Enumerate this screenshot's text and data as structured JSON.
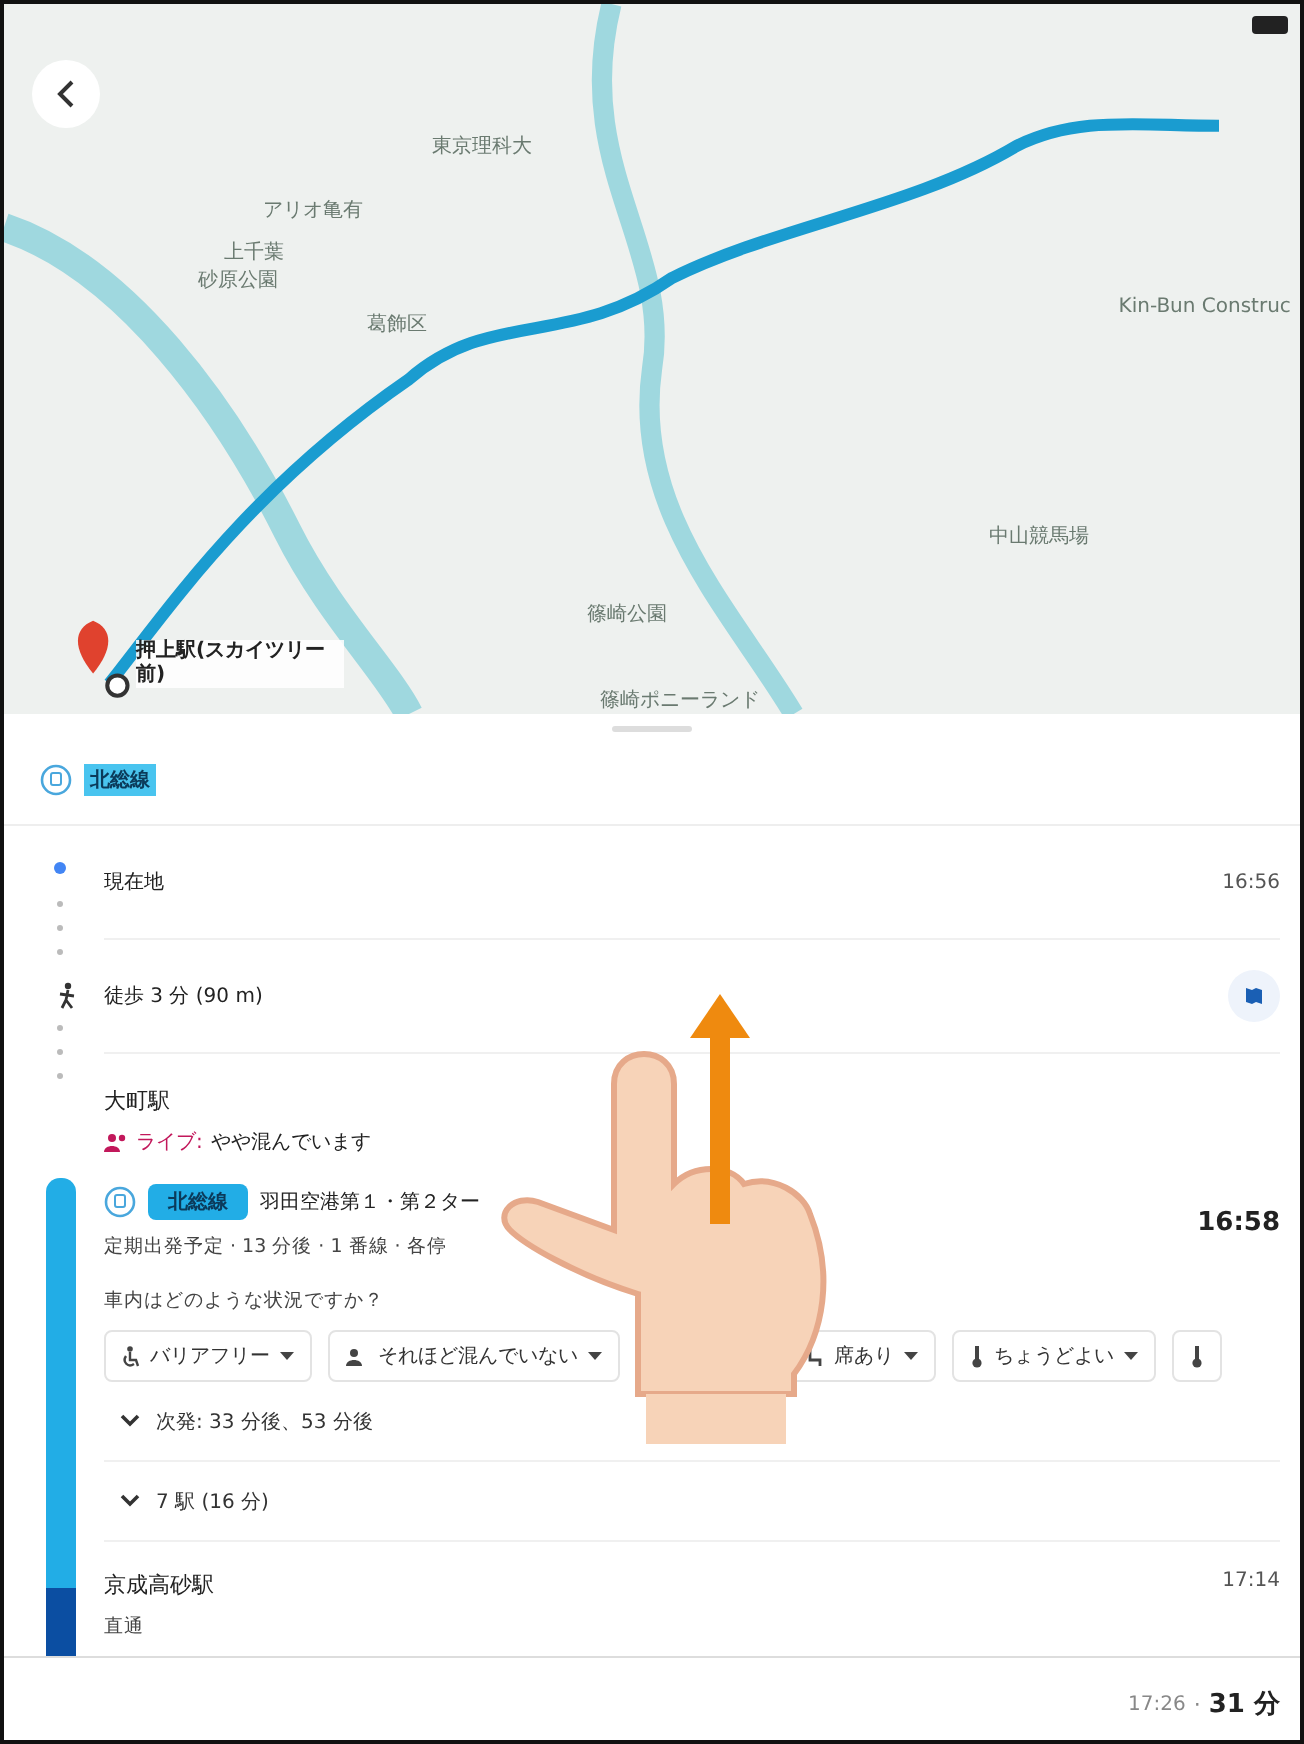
{
  "map": {
    "labels": [
      {
        "text": "東京理科大"
      },
      {
        "text": "アリオ亀有"
      },
      {
        "text": "上千葉"
      },
      {
        "text": "砂原公園"
      },
      {
        "text": "葛飾区"
      },
      {
        "text": "中山競馬場"
      },
      {
        "text": "篠崎公園"
      },
      {
        "text": "篠崎ポニーランド"
      },
      {
        "text": "Kin-Bun Construc"
      }
    ],
    "destination": "押上駅(スカイツリー前)"
  },
  "route_header": {
    "line": "北総線"
  },
  "steps": [
    {
      "kind": "place",
      "name": "現在地",
      "time": "16:56"
    },
    {
      "kind": "walk",
      "name": "徒歩 3 分 (90 m)"
    }
  ],
  "station": {
    "name": "大町駅",
    "live_label": "ライブ:",
    "live_text": "やや混んでいます",
    "line": "北総線",
    "direction": "羽田空港第１・第２ター",
    "time": "16:58",
    "details": "定期出発予定 · 13 分後 · 1 番線 · 各停",
    "question": "車内はどのような状況ですか？",
    "chips": [
      {
        "kind": "accessibility",
        "label": "バリアフリー"
      },
      {
        "kind": "crowd",
        "label": "それほど混んでいない"
      },
      {
        "kind": "seat",
        "label": "席あり"
      },
      {
        "kind": "temperature",
        "label": "ちょうどよい"
      },
      {
        "kind": "temperature"
      }
    ],
    "expanders": [
      {
        "text": "次発: 33 分後、53 分後",
        "expanded": false
      },
      {
        "text": "7 駅 (16 分)",
        "expanded": false
      }
    ]
  },
  "arrival": {
    "name": "京成高砂駅",
    "time": "17:14",
    "note": "直通"
  },
  "footer": {
    "arrival": "17:26",
    "separator": "·",
    "duration": "31 分"
  }
}
